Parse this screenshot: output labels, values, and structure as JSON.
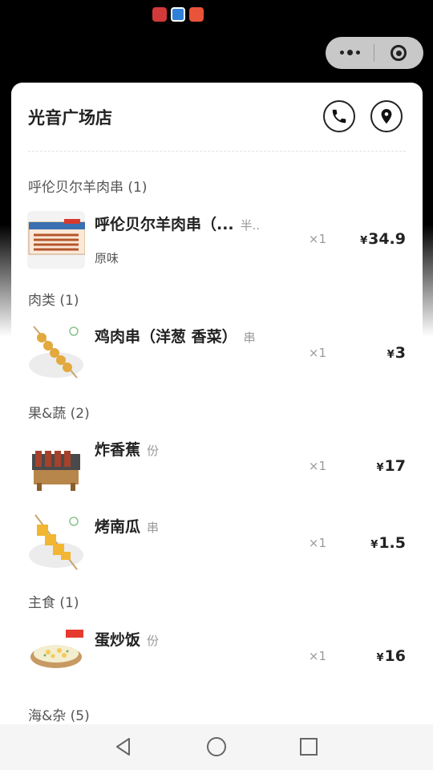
{
  "store": {
    "name": "光音广场店"
  },
  "sections": [
    {
      "title": "呼伦贝尔羊肉串 (1)"
    },
    {
      "title": "肉类 (1)"
    },
    {
      "title": "果&蔬 (2)"
    },
    {
      "title": "主食 (1)"
    },
    {
      "title": "海&杂 (5)"
    }
  ],
  "items": [
    {
      "name": "呼伦贝尔羊肉串（...",
      "unit": "半..",
      "spec": "原味",
      "qty": "×1",
      "currency": "¥",
      "price": "34.9"
    },
    {
      "name": "鸡肉串（洋葱 香菜）",
      "unit": "串",
      "qty": "×1",
      "currency": "¥",
      "price": "3"
    },
    {
      "name": "炸香蕉",
      "unit": "份",
      "qty": "×1",
      "currency": "¥",
      "price": "17"
    },
    {
      "name": "烤南瓜",
      "unit": "串",
      "qty": "×1",
      "currency": "¥",
      "price": "1.5"
    },
    {
      "name": "蛋炒饭",
      "unit": "份",
      "qty": "×1",
      "currency": "¥",
      "price": "16"
    }
  ],
  "icons": {
    "phone": "phone-icon",
    "location": "location-pin-icon",
    "capsule_more": "more-dots-icon",
    "capsule_close": "target-icon"
  }
}
